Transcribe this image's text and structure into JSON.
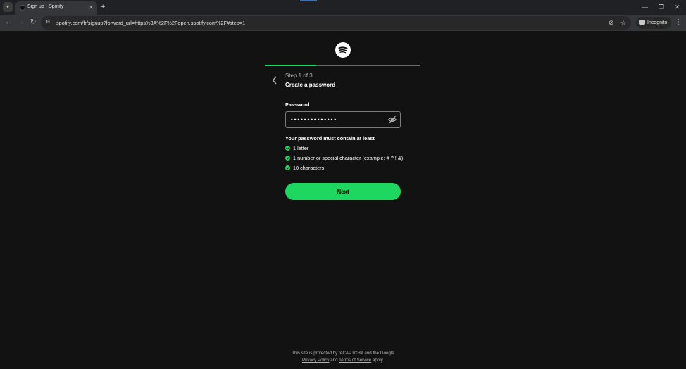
{
  "browser": {
    "tab_title": "Sign up - Spotify",
    "url": "spotify.com/fr/signup?forward_url=https%3A%2F%2Fopen.spotify.com%2F#step=1",
    "incognito_label": "Incognito"
  },
  "signup": {
    "progress": 0.33,
    "step_label": "Step 1 of 3",
    "step_title": "Create a password",
    "password_label": "Password",
    "password_value": "••••••••••••••",
    "requirements_title": "Your password must contain at least",
    "requirements": [
      "1 letter",
      "1 number or special character (example: # ? ! &)",
      "10 characters"
    ],
    "next_label": "Next"
  },
  "footer": {
    "line1": "This site is protected by reCAPTCHA and the Google",
    "privacy": "Privacy Policy",
    "and": "and",
    "terms": "Terms of Service",
    "apply": "apply."
  },
  "colors": {
    "accent": "#1ed760",
    "background": "#121212"
  }
}
